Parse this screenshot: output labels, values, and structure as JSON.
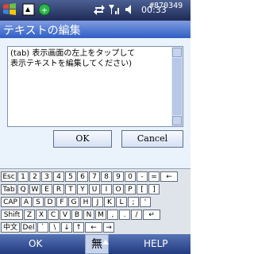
{
  "status": {
    "time": "00:33",
    "watermark": "#870349"
  },
  "heading": "テキストの編集",
  "editor": {
    "text": "(tab) 表示画面の左上をタップして\n表示テキストを編集してください)"
  },
  "buttons": {
    "ok": "OK",
    "cancel": "Cancel"
  },
  "keyboard": {
    "row1": [
      "Esc",
      "1",
      "2",
      "3",
      "4",
      "5",
      "6",
      "7",
      "8",
      "9",
      "0",
      "-",
      "=",
      "←"
    ],
    "row2": [
      "Tab",
      "Q",
      "W",
      "E",
      "R",
      "T",
      "Y",
      "U",
      "I",
      "O",
      "P",
      "[",
      "]"
    ],
    "row3": [
      "CAP",
      "A",
      "S",
      "D",
      "F",
      "G",
      "H",
      "J",
      "K",
      "L",
      ";",
      "'"
    ],
    "row4": [
      "Shift",
      "Z",
      "X",
      "C",
      "V",
      "B",
      "N",
      "M",
      ",",
      ".",
      "/",
      "↵"
    ],
    "row5": [
      "中文",
      "Del",
      "`",
      "\\",
      "↓",
      "↑",
      "←",
      "→"
    ]
  },
  "menubar": {
    "left": "OK",
    "right": "HELP",
    "ime": "無"
  }
}
